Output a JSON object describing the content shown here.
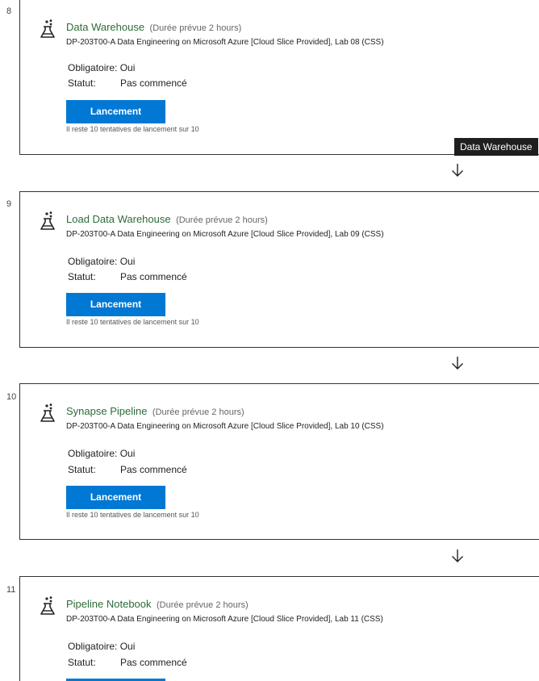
{
  "labels": {
    "required_label": "Obligatoire:",
    "status_label": "Statut:",
    "launch_button": "Lancement"
  },
  "tooltip": "Data Warehouse",
  "steps": [
    {
      "number": "8",
      "title": "Data Warehouse",
      "duration": "(Durée prévue 2 hours)",
      "course": "DP-203T00-A Data Engineering on Microsoft Azure [Cloud Slice Provided], Lab 08 (CSS)",
      "required": "Oui",
      "status": "Pas commencé",
      "attempts": "Il reste 10 tentatives de lancement sur 10"
    },
    {
      "number": "9",
      "title": "Load Data Warehouse",
      "duration": "(Durée prévue 2 hours)",
      "course": "DP-203T00-A Data Engineering on Microsoft Azure [Cloud Slice Provided], Lab 09 (CSS)",
      "required": "Oui",
      "status": "Pas commencé",
      "attempts": "Il reste 10 tentatives de lancement sur 10"
    },
    {
      "number": "10",
      "title": "Synapse Pipeline",
      "duration": "(Durée prévue 2 hours)",
      "course": "DP-203T00-A Data Engineering on Microsoft Azure [Cloud Slice Provided], Lab 10 (CSS)",
      "required": "Oui",
      "status": "Pas commencé",
      "attempts": "Il reste 10 tentatives de lancement sur 10"
    },
    {
      "number": "11",
      "title": "Pipeline Notebook",
      "duration": "(Durée prévue 2 hours)",
      "course": "DP-203T00-A Data Engineering on Microsoft Azure [Cloud Slice Provided], Lab 11 (CSS)",
      "required": "Oui",
      "status": "Pas commencé"
    }
  ],
  "colors": {
    "title_green": "#2d6b3a",
    "button_blue": "#0078d4",
    "tooltip_bg": "#1f1f1f"
  },
  "icons": {
    "lab": "flask-icon",
    "connector": "arrow-down-icon"
  }
}
